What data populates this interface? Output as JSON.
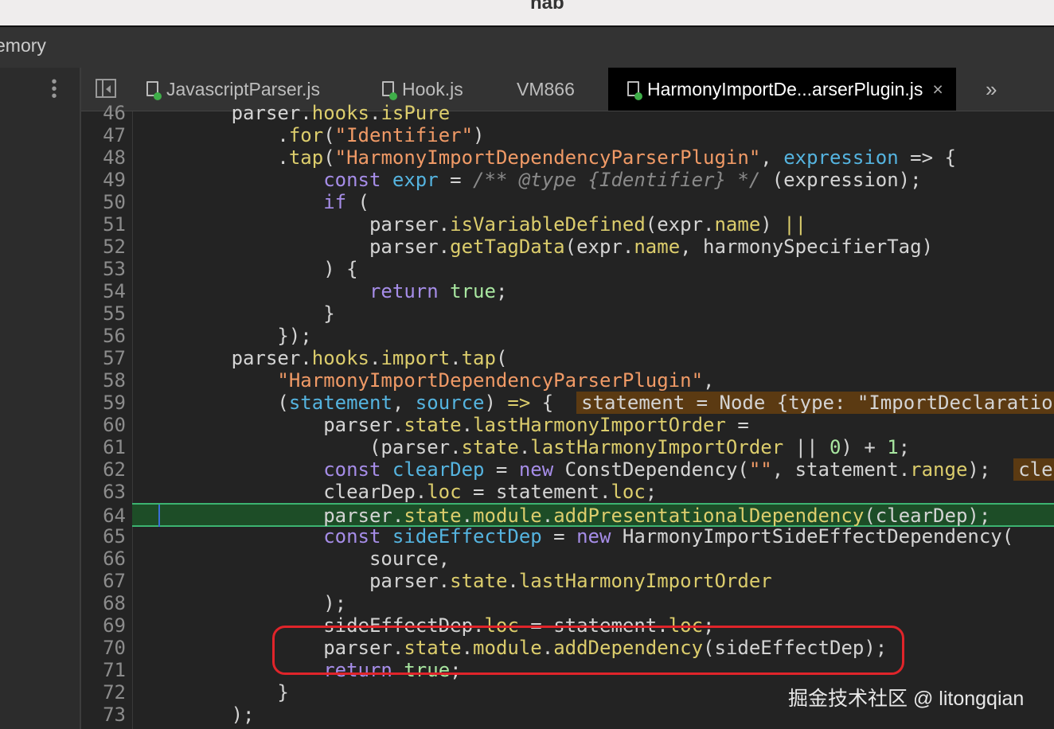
{
  "window": {
    "title": "nab",
    "panel_label": "emory"
  },
  "tabs": [
    {
      "label": "JavascriptParser.js",
      "icon": "file-icon"
    },
    {
      "label": "Hook.js",
      "icon": "file-icon"
    },
    {
      "label": "VM866"
    },
    {
      "label": "HarmonyImportDe...arserPlugin.js",
      "icon": "file-icon",
      "active": true,
      "close": "×"
    }
  ],
  "more_tabs": "»",
  "editor": {
    "current_line": 64,
    "lines": [
      {
        "n": "46",
        "t": [
          [
            "        parser.",
            ""
          ],
          [
            "hooks",
            "prop"
          ],
          [
            ".",
            ""
          ],
          [
            "isPure",
            "prop"
          ]
        ]
      },
      {
        "n": "47",
        "t": [
          [
            "            .",
            ""
          ],
          [
            "for",
            "prop"
          ],
          [
            "(",
            ""
          ],
          [
            "\"Identifier\"",
            "str"
          ],
          [
            ")",
            ""
          ]
        ]
      },
      {
        "n": "48",
        "t": [
          [
            "            .",
            ""
          ],
          [
            "tap",
            "prop"
          ],
          [
            "(",
            ""
          ],
          [
            "\"HarmonyImportDependencyParserPlugin\"",
            "str"
          ],
          [
            ", ",
            ""
          ],
          [
            "expression",
            "var"
          ],
          [
            " => {",
            ""
          ]
        ]
      },
      {
        "n": "49",
        "t": [
          [
            "                ",
            ""
          ],
          [
            "const",
            "kw"
          ],
          [
            " ",
            ""
          ],
          [
            "expr",
            "var"
          ],
          [
            " = ",
            ""
          ],
          [
            "/** @type {Identifier} */",
            "cmt"
          ],
          [
            " (expression);",
            ""
          ]
        ]
      },
      {
        "n": "50",
        "t": [
          [
            "                ",
            ""
          ],
          [
            "if",
            "kw"
          ],
          [
            " (",
            ""
          ]
        ]
      },
      {
        "n": "51",
        "t": [
          [
            "                    parser.",
            ""
          ],
          [
            "isVariableDefined",
            "prop"
          ],
          [
            "(expr.",
            ""
          ],
          [
            "name",
            "prop"
          ],
          [
            ") ",
            ""
          ],
          [
            "||",
            "prop"
          ]
        ]
      },
      {
        "n": "52",
        "t": [
          [
            "                    parser.",
            ""
          ],
          [
            "getTagData",
            "prop"
          ],
          [
            "(expr.",
            ""
          ],
          [
            "name",
            "prop"
          ],
          [
            ", harmonySpecifierTag)",
            ""
          ]
        ]
      },
      {
        "n": "53",
        "t": [
          [
            "                ) {",
            ""
          ]
        ]
      },
      {
        "n": "54",
        "t": [
          [
            "                    ",
            ""
          ],
          [
            "return",
            "kw"
          ],
          [
            " ",
            ""
          ],
          [
            "true",
            "num"
          ],
          [
            ";",
            ""
          ]
        ]
      },
      {
        "n": "55",
        "t": [
          [
            "                }",
            ""
          ]
        ]
      },
      {
        "n": "56",
        "t": [
          [
            "            });",
            ""
          ]
        ]
      },
      {
        "n": "57",
        "t": [
          [
            "        parser.",
            ""
          ],
          [
            "hooks",
            "prop"
          ],
          [
            ".",
            ""
          ],
          [
            "import",
            "prop"
          ],
          [
            ".",
            ""
          ],
          [
            "tap",
            "prop"
          ],
          [
            "(",
            ""
          ]
        ]
      },
      {
        "n": "58",
        "t": [
          [
            "            ",
            ""
          ],
          [
            "\"HarmonyImportDependencyParserPlugin\"",
            "str"
          ],
          [
            ",",
            ""
          ]
        ]
      },
      {
        "n": "59",
        "t": [
          [
            "            (",
            ""
          ],
          [
            "statement",
            "var"
          ],
          [
            ", ",
            ""
          ],
          [
            "source",
            "var"
          ],
          [
            ") ",
            ""
          ],
          [
            "=>",
            "prop"
          ],
          [
            " {  ",
            ""
          ],
          [
            "statement = Node {type: \"ImportDeclaration\"",
            "inl"
          ]
        ]
      },
      {
        "n": "60",
        "t": [
          [
            "                parser.",
            ""
          ],
          [
            "state",
            "prop"
          ],
          [
            ".",
            ""
          ],
          [
            "lastHarmonyImportOrder",
            "prop"
          ],
          [
            " =",
            ""
          ]
        ]
      },
      {
        "n": "61",
        "t": [
          [
            "                    (parser.",
            ""
          ],
          [
            "state",
            "prop"
          ],
          [
            ".",
            ""
          ],
          [
            "lastHarmonyImportOrder",
            "prop"
          ],
          [
            " || ",
            ""
          ],
          [
            "0",
            "num"
          ],
          [
            ") + ",
            ""
          ],
          [
            "1",
            "num"
          ],
          [
            ";",
            ""
          ]
        ]
      },
      {
        "n": "62",
        "t": [
          [
            "                ",
            ""
          ],
          [
            "const",
            "kw"
          ],
          [
            " ",
            ""
          ],
          [
            "clearDep",
            "var"
          ],
          [
            " = ",
            ""
          ],
          [
            "new",
            "kw"
          ],
          [
            " ConstDependency(",
            ""
          ],
          [
            "\"\"",
            "str"
          ],
          [
            ", statement.",
            ""
          ],
          [
            "range",
            "prop"
          ],
          [
            ");  ",
            ""
          ],
          [
            "clea",
            "inl"
          ]
        ]
      },
      {
        "n": "63",
        "t": [
          [
            "                clearDep.",
            ""
          ],
          [
            "loc",
            "prop"
          ],
          [
            " = statement.",
            ""
          ],
          [
            "loc",
            "prop"
          ],
          [
            ";",
            ""
          ]
        ]
      },
      {
        "n": "64",
        "t": [
          [
            "                parser.",
            ""
          ],
          [
            "state",
            "prop"
          ],
          [
            ".",
            ""
          ],
          [
            "module",
            "prop"
          ],
          [
            ".",
            ""
          ],
          [
            "addPresentationalDependency",
            "prop"
          ],
          [
            "(clearDep);",
            ""
          ]
        ]
      },
      {
        "n": "65",
        "t": [
          [
            "                ",
            ""
          ],
          [
            "const",
            "kw"
          ],
          [
            " ",
            ""
          ],
          [
            "sideEffectDep",
            "var"
          ],
          [
            " = ",
            ""
          ],
          [
            "new",
            "kw"
          ],
          [
            " HarmonyImportSideEffectDependency(",
            ""
          ]
        ]
      },
      {
        "n": "66",
        "t": [
          [
            "                    source,",
            ""
          ]
        ]
      },
      {
        "n": "67",
        "t": [
          [
            "                    parser.",
            ""
          ],
          [
            "state",
            "prop"
          ],
          [
            ".",
            ""
          ],
          [
            "lastHarmonyImportOrder",
            "prop"
          ]
        ]
      },
      {
        "n": "68",
        "t": [
          [
            "                );",
            ""
          ]
        ]
      },
      {
        "n": "69",
        "t": [
          [
            "                sideEffectDep.",
            ""
          ],
          [
            "loc",
            "prop"
          ],
          [
            " = statement.",
            ""
          ],
          [
            "loc",
            "prop"
          ],
          [
            ";",
            ""
          ]
        ]
      },
      {
        "n": "70",
        "t": [
          [
            "                parser.",
            ""
          ],
          [
            "state",
            "prop"
          ],
          [
            ".",
            ""
          ],
          [
            "module",
            "prop"
          ],
          [
            ".",
            ""
          ],
          [
            "addDependency",
            "prop"
          ],
          [
            "(sideEffectDep);",
            ""
          ]
        ]
      },
      {
        "n": "71",
        "t": [
          [
            "                ",
            ""
          ],
          [
            "return",
            "kw"
          ],
          [
            " ",
            ""
          ],
          [
            "true",
            "num"
          ],
          [
            ";",
            ""
          ]
        ]
      },
      {
        "n": "72",
        "t": [
          [
            "            }",
            ""
          ]
        ]
      },
      {
        "n": "73",
        "t": [
          [
            "        );",
            ""
          ]
        ]
      }
    ]
  },
  "watermark": "掘金技术社区 @ litongqian",
  "colors": {
    "annotation": "#e0242a",
    "current_line": "#1d4d27"
  }
}
